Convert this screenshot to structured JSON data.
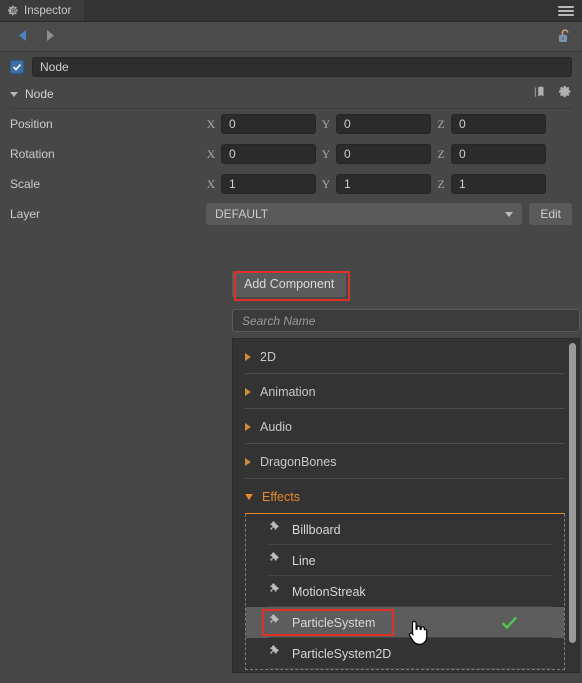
{
  "window": {
    "tab_label": "Inspector",
    "tab_icon": "gear-icon",
    "menu_icon": "hamburger-menu-icon"
  },
  "navbar": {
    "back_icon": "arrow-left-icon",
    "forward_icon": "arrow-right-icon",
    "lock_icon": "unlocked-padlock-icon"
  },
  "node": {
    "enabled": true,
    "name_value": "Node",
    "section_title": "Node",
    "help_icon": "book-icon",
    "settings_icon": "gear-icon",
    "properties": [
      {
        "label": "Position",
        "x": "0",
        "y": "0",
        "z": "0"
      },
      {
        "label": "Rotation",
        "x": "0",
        "y": "0",
        "z": "0"
      },
      {
        "label": "Scale",
        "x": "1",
        "y": "1",
        "z": "1"
      }
    ],
    "axis_labels": {
      "x": "X",
      "y": "Y",
      "z": "Z"
    },
    "layer": {
      "label": "Layer",
      "value": "DEFAULT",
      "edit_label": "Edit",
      "chevron_icon": "chevron-down-icon"
    }
  },
  "add_component": {
    "button_label": "Add Component",
    "search_placeholder": "Search Name",
    "highlight_color": "#e03127",
    "accent_color": "#e8882a",
    "check_color": "#4ec94e",
    "categories": [
      {
        "label": "2D",
        "expanded": false
      },
      {
        "label": "Animation",
        "expanded": false
      },
      {
        "label": "Audio",
        "expanded": false
      },
      {
        "label": "DragonBones",
        "expanded": false
      },
      {
        "label": "Effects",
        "expanded": true
      }
    ],
    "effects_items": [
      {
        "label": "Billboard",
        "selected": false,
        "checked": false
      },
      {
        "label": "Line",
        "selected": false,
        "checked": false
      },
      {
        "label": "MotionStreak",
        "selected": false,
        "checked": false
      },
      {
        "label": "ParticleSystem",
        "selected": true,
        "checked": true
      },
      {
        "label": "ParticleSystem2D",
        "selected": false,
        "checked": false
      }
    ],
    "item_icon": "puzzle-piece-icon",
    "check_icon": "checkmark-icon"
  },
  "cursor": {
    "icon": "pointing-hand-cursor"
  }
}
